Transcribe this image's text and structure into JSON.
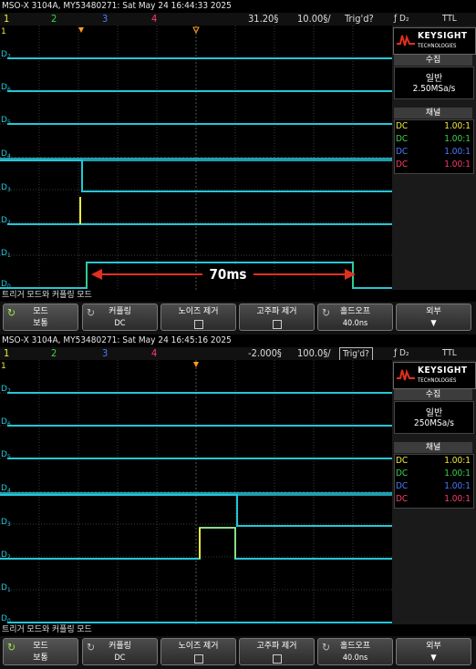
{
  "screens": [
    {
      "header": "MSO-X 3104A, MY53480271: Sat May 24 16:44:33 2025",
      "channels": [
        "1",
        "2",
        "3",
        "4"
      ],
      "time_ref": "31.20§",
      "time_scale": "10.00§/",
      "trig_status": "Trig'd?",
      "trig_flag": "ƒ D₂",
      "trig_level": "TTL",
      "measurement": "70ms",
      "logo": {
        "line1": "KEYSIGHT",
        "line2": "TECHNOLOGIES"
      },
      "acquire": {
        "header": "수집",
        "mode": "일반",
        "rate": "2.50MSa/s"
      },
      "channel_panel": {
        "header": "채널",
        "rows": [
          {
            "coupling": "DC",
            "scale": "1.00:1",
            "color": "#f1ec3c"
          },
          {
            "coupling": "DC",
            "scale": "1.00:1",
            "color": "#3cd34a"
          },
          {
            "coupling": "DC",
            "scale": "1.00:1",
            "color": "#4a7bff"
          },
          {
            "coupling": "DC",
            "scale": "1.00:1",
            "color": "#ff3b6b"
          }
        ]
      },
      "digital_labels": [
        "D7",
        "D6",
        "D5",
        "D4",
        "D3",
        "D2",
        "D1",
        "D0"
      ],
      "softkey_title": "트리거 모드와 커플링 모드",
      "softkeys": [
        {
          "label": "모드",
          "value": "보통"
        },
        {
          "label": "커플링",
          "value": "DC"
        },
        {
          "label": "노이즈 제거",
          "value": ""
        },
        {
          "label": "고주파 제거",
          "value": ""
        },
        {
          "label": "홀드오프",
          "value": "40.0ns"
        },
        {
          "label": "외부",
          "value": ""
        }
      ]
    },
    {
      "header": "MSO-X 3104A, MY53480271: Sat May 24 16:45:16 2025",
      "channels": [
        "1",
        "2",
        "3",
        "4"
      ],
      "time_ref": "-2.000§",
      "time_scale": "100.0§/",
      "trig_status": "Trig'd?",
      "trig_flag": "ƒ D₂",
      "trig_level": "TTL",
      "logo": {
        "line1": "KEYSIGHT",
        "line2": "TECHNOLOGIES"
      },
      "acquire": {
        "header": "수집",
        "mode": "일반",
        "rate": "250MSa/s"
      },
      "channel_panel": {
        "header": "채널",
        "rows": [
          {
            "coupling": "DC",
            "scale": "1.00:1",
            "color": "#f1ec3c"
          },
          {
            "coupling": "DC",
            "scale": "1.00:1",
            "color": "#3cd34a"
          },
          {
            "coupling": "DC",
            "scale": "1.00:1",
            "color": "#4a7bff"
          },
          {
            "coupling": "DC",
            "scale": "1.00:1",
            "color": "#ff3b6b"
          }
        ]
      },
      "digital_labels": [
        "D7",
        "D6",
        "D5",
        "D4",
        "D3",
        "D2",
        "D1",
        "D0"
      ],
      "softkey_title": "트리거 모드와 커플링 모드",
      "softkeys": [
        {
          "label": "모드",
          "value": "보통"
        },
        {
          "label": "커플링",
          "value": "DC"
        },
        {
          "label": "노이즈 제거",
          "value": ""
        },
        {
          "label": "고주파 제거",
          "value": ""
        },
        {
          "label": "홀드오프",
          "value": "40.0ns"
        },
        {
          "label": "외부",
          "value": ""
        }
      ]
    }
  ],
  "colors": {
    "trace": "#25c6d8",
    "accent_green": "#3cd34a",
    "marker": "#e0301e",
    "trigger": "#ff9f1a"
  }
}
